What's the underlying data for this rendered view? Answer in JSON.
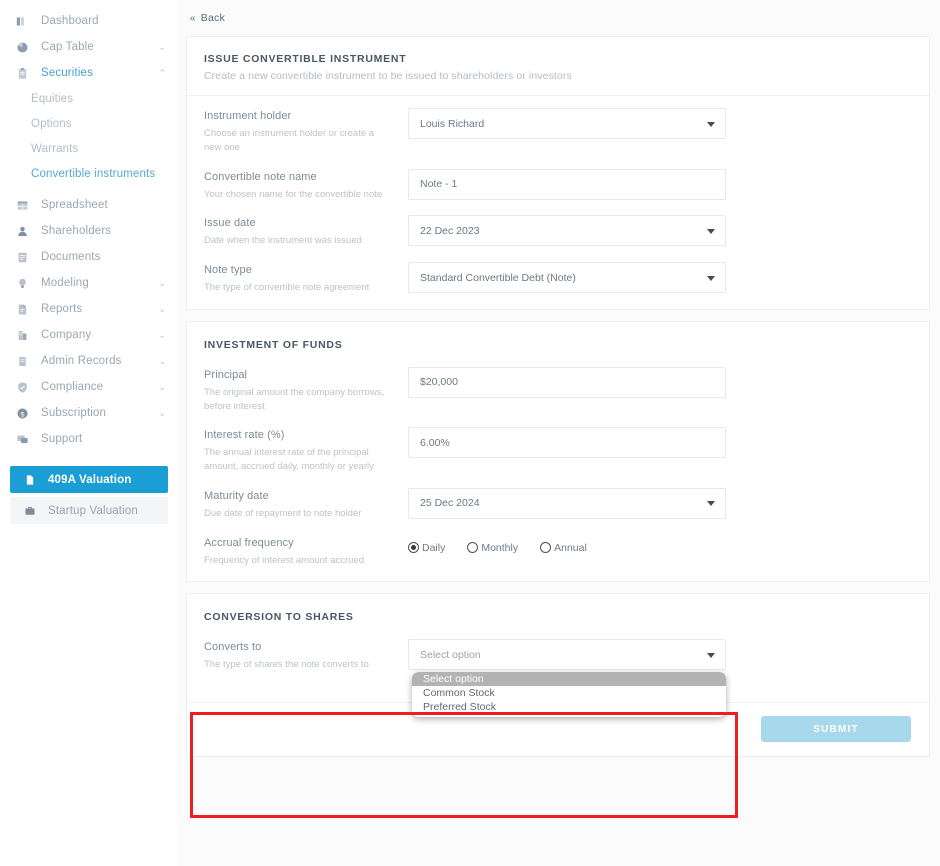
{
  "sidebar": {
    "items": [
      {
        "label": "Dashboard",
        "icon": "dashboard-icon",
        "chevron": "",
        "accent": false
      },
      {
        "label": "Cap Table",
        "icon": "pie-chart-icon",
        "chevron": "⌄",
        "accent": false
      },
      {
        "label": "Securities",
        "icon": "clipboard-icon",
        "chevron": "⌃",
        "accent": true
      },
      {
        "label": "Spreadsheet",
        "icon": "grid-icon",
        "chevron": "",
        "accent": false
      },
      {
        "label": "Shareholders",
        "icon": "person-icon",
        "chevron": "",
        "accent": false
      },
      {
        "label": "Documents",
        "icon": "document-icon",
        "chevron": "",
        "accent": false
      },
      {
        "label": "Modeling",
        "icon": "lightbulb-icon",
        "chevron": "⌄",
        "accent": false
      },
      {
        "label": "Reports",
        "icon": "report-icon",
        "chevron": "⌄",
        "accent": false
      },
      {
        "label": "Company",
        "icon": "building-icon",
        "chevron": "⌄",
        "accent": false
      },
      {
        "label": "Admin Records",
        "icon": "archive-icon",
        "chevron": "⌄",
        "accent": false
      },
      {
        "label": "Compliance",
        "icon": "shield-check-icon",
        "chevron": "⌄",
        "accent": false
      },
      {
        "label": "Subscription",
        "icon": "dollar-circle-icon",
        "chevron": "⌄",
        "accent": false
      },
      {
        "label": "Support",
        "icon": "chat-icon",
        "chevron": "",
        "accent": false
      }
    ],
    "securities_submenu": [
      {
        "label": "Equities",
        "active": false
      },
      {
        "label": "Options",
        "active": false
      },
      {
        "label": "Warrants",
        "active": false
      },
      {
        "label": "Convertible instruments",
        "active": true
      }
    ],
    "buttons": [
      {
        "label": "409A Valuation",
        "icon": "file-icon",
        "style": "primary"
      },
      {
        "label": "Startup Valuation",
        "icon": "briefcase-icon",
        "style": "ghost"
      }
    ]
  },
  "header": {
    "back_label": "Back",
    "back_icon": "double-chevron-left-icon"
  },
  "cards": {
    "issue": {
      "title": "ISSUE CONVERTIBLE INSTRUMENT",
      "subtitle": "Create a new convertible instrument to be issued to shareholders or investors",
      "fields": [
        {
          "label": "Instrument holder",
          "help": "Choose an instrument holder or create a new one",
          "control": "select",
          "value": "Louis Richard"
        },
        {
          "label": "Convertible note name",
          "help": "Your chosen name for the convertible note",
          "control": "input",
          "value": "Note - 1"
        },
        {
          "label": "Issue date",
          "help": "Date when the instrument was issued",
          "control": "select",
          "value": "22 Dec 2023"
        },
        {
          "label": "Note type",
          "help": "The type of convertible note agreement",
          "control": "select",
          "value": "Standard Convertible Debt (Note)"
        }
      ]
    },
    "investment": {
      "title": "INVESTMENT OF FUNDS",
      "fields": [
        {
          "label": "Principal",
          "help": "The original amount the company borrows, before interest",
          "control": "input",
          "value": "$20,000"
        },
        {
          "label": "Interest rate (%)",
          "help": "The annual interest rate of the principal amount, accrued daily, monthly or yearly",
          "control": "input",
          "value": "6.00%"
        },
        {
          "label": "Maturity date",
          "help": "Due date of repayment to note holder",
          "control": "select",
          "value": "25 Dec 2024"
        }
      ],
      "accrual": {
        "label": "Accrual frequency",
        "help": "Frequency of interest amount accrued",
        "options": [
          {
            "label": "Daily",
            "selected": true
          },
          {
            "label": "Monthly",
            "selected": false
          },
          {
            "label": "Annual",
            "selected": false
          }
        ]
      }
    },
    "conversion": {
      "title": "CONVERSION TO SHARES",
      "field": {
        "label": "Converts to",
        "help": "The type of shares the note converts to",
        "value": "Select option",
        "dropdown_open": true,
        "options": [
          {
            "label": "Select option",
            "highlighted": true
          },
          {
            "label": "Common Stock",
            "highlighted": false
          },
          {
            "label": "Preferred Stock",
            "highlighted": false
          }
        ]
      },
      "submit_label": "SUBMIT"
    }
  },
  "colors": {
    "accent": "#1a9ed4",
    "submit_disabled": "#a8d8eb",
    "annotation": "#ef1c24",
    "label": "#7d8b98",
    "help": "#bcc3ca"
  }
}
